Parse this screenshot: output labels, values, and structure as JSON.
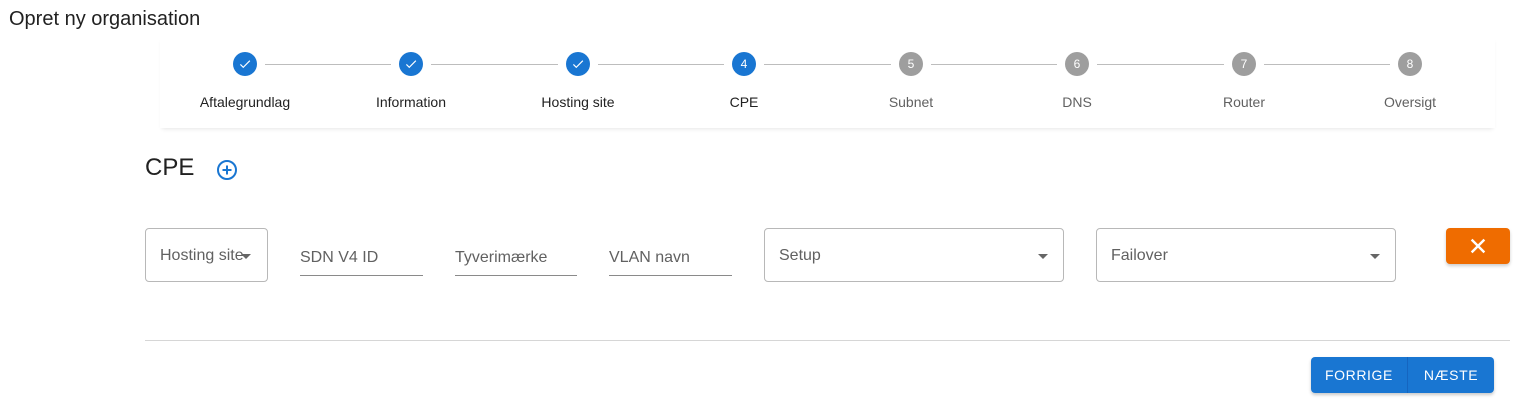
{
  "page": {
    "title": "Opret ny organisation"
  },
  "stepper": {
    "steps": [
      {
        "number": "1",
        "label": "Aftalegrundlag",
        "state": "done"
      },
      {
        "number": "2",
        "label": "Information",
        "state": "done"
      },
      {
        "number": "3",
        "label": "Hosting site",
        "state": "done"
      },
      {
        "number": "4",
        "label": "CPE",
        "state": "active"
      },
      {
        "number": "5",
        "label": "Subnet",
        "state": "todo"
      },
      {
        "number": "6",
        "label": "DNS",
        "state": "todo"
      },
      {
        "number": "7",
        "label": "Router",
        "state": "todo"
      },
      {
        "number": "8",
        "label": "Oversigt",
        "state": "todo"
      }
    ]
  },
  "section": {
    "title": "CPE",
    "add_icon": "add-circle-outline-icon"
  },
  "form": {
    "hosting_site": {
      "label": "Hosting site",
      "value": ""
    },
    "sdn_v4_id": {
      "placeholder": "SDN V4 ID",
      "value": ""
    },
    "tyverimaerke": {
      "placeholder": "Tyverimærke",
      "value": ""
    },
    "vlan_navn": {
      "placeholder": "VLAN navn",
      "value": ""
    },
    "setup": {
      "label": "Setup",
      "value": ""
    },
    "failover": {
      "label": "Failover",
      "value": ""
    }
  },
  "remove_button": {
    "icon": "close-icon"
  },
  "nav": {
    "prev_label": "FORRIGE",
    "next_label": "NÆSTE"
  },
  "colors": {
    "primary": "#1976d2",
    "inactive": "#9e9e9e",
    "warn": "#ef6c00"
  }
}
